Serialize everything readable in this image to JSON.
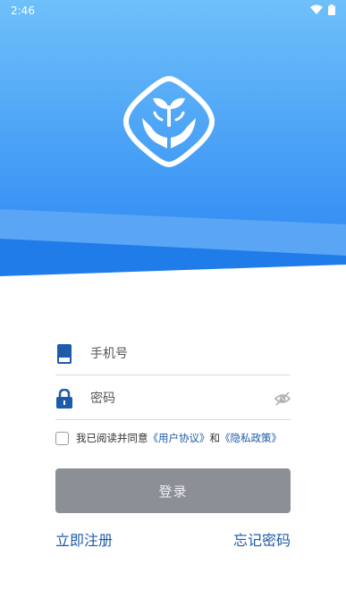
{
  "status_bar": {
    "time": "2:46",
    "icons": [
      "wifi-icon",
      "battery-icon"
    ]
  },
  "logo": {
    "icon": "hands-sprout-logo"
  },
  "form": {
    "phone_placeholder": "手机号",
    "password_placeholder": "密码",
    "phone_icon": "phone-icon",
    "password_icon": "lock-icon",
    "visibility_icon": "eye-off-icon"
  },
  "agreement": {
    "checked": false,
    "prefix": "我已阅读并同意",
    "user_agreement": "《用户协议》",
    "conjunction": "和",
    "privacy_policy": "《隐私政策》"
  },
  "login_button": "登录",
  "links": {
    "register": "立即注册",
    "forgot": "忘记密码"
  },
  "colors": {
    "primary": "#2f8cf0",
    "link": "#1e5ba8",
    "button_disabled": "#8c9096"
  }
}
